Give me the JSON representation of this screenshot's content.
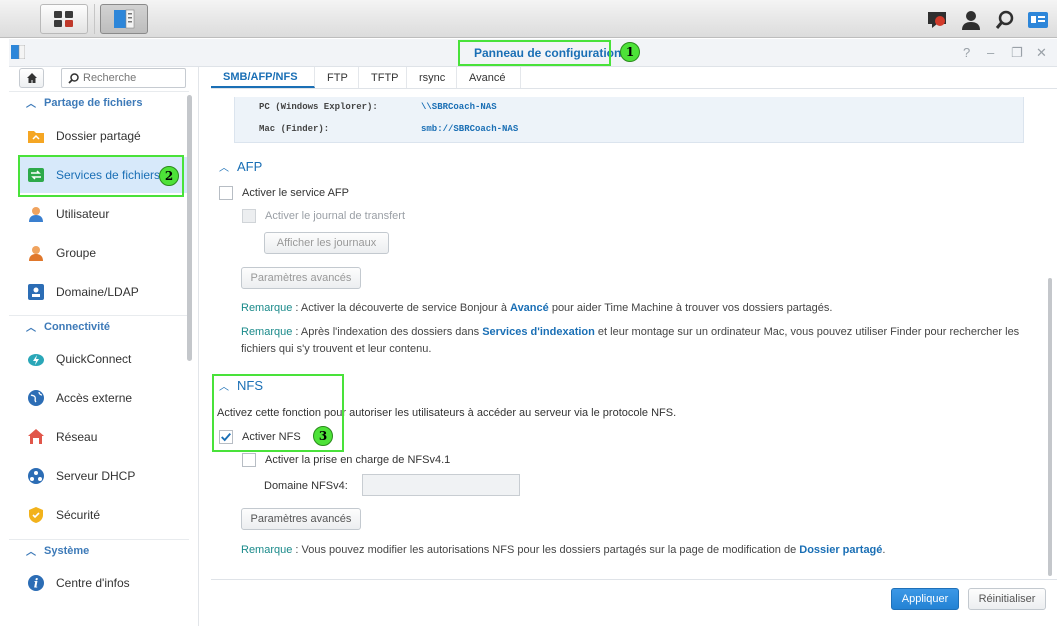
{
  "window": {
    "title": "Panneau de configuration",
    "controls": [
      "?",
      "–",
      "❐",
      "✕"
    ]
  },
  "annotations": [
    "1",
    "2",
    "3"
  ],
  "sidebar": {
    "search_placeholder": "Recherche",
    "sections": [
      {
        "label": "Partage de fichiers",
        "items": [
          {
            "label": "Dossier partagé",
            "icon": "folder-share-icon"
          },
          {
            "label": "Services de fichiers",
            "icon": "file-services-icon",
            "active": true
          },
          {
            "label": "Utilisateur",
            "icon": "user-icon"
          },
          {
            "label": "Groupe",
            "icon": "group-icon"
          },
          {
            "label": "Domaine/LDAP",
            "icon": "domain-ldap-icon"
          }
        ]
      },
      {
        "label": "Connectivité",
        "items": [
          {
            "label": "QuickConnect",
            "icon": "quickconnect-icon"
          },
          {
            "label": "Accès externe",
            "icon": "external-access-icon"
          },
          {
            "label": "Réseau",
            "icon": "network-icon"
          },
          {
            "label": "Serveur DHCP",
            "icon": "dhcp-server-icon"
          },
          {
            "label": "Sécurité",
            "icon": "security-icon"
          }
        ]
      },
      {
        "label": "Système",
        "items": [
          {
            "label": "Centre d'infos",
            "icon": "info-center-icon"
          }
        ]
      }
    ]
  },
  "tabs": [
    "SMB/AFP/NFS",
    "FTP",
    "TFTP",
    "rsync",
    "Avancé"
  ],
  "active_tab": "SMB/AFP/NFS",
  "access": {
    "pc_label": "PC (Windows Explorer):",
    "pc_value": "\\\\SBRCoach-NAS",
    "mac_label": "Mac (Finder):",
    "mac_value": "smb://SBRCoach-NAS"
  },
  "afp": {
    "title": "AFP",
    "enable_label": "Activer le service AFP",
    "enable_checked": false,
    "log_label": "Activer le journal de transfert",
    "show_logs_button": "Afficher les journaux",
    "advanced_button": "Paramètres avancés",
    "note1": {
      "prefix": "Remarque",
      "text_a": " : Activer la découverte de service Bonjour à ",
      "link": "Avancé",
      "text_b": " pour aider Time Machine à trouver vos dossiers partagés."
    },
    "note2": {
      "prefix": "Remarque",
      "text_a": " : Après l'indexation des dossiers dans ",
      "link": "Services d'indexation",
      "text_b": " et leur montage sur un ordinateur Mac, vous pouvez utiliser Finder pour rechercher les fichiers qui s'y trouvent et leur contenu."
    }
  },
  "nfs": {
    "title": "NFS",
    "description": "Activez cette fonction pour autoriser les utilisateurs à accéder au serveur via le protocole NFS.",
    "enable_label": "Activer NFS",
    "enable_checked": true,
    "nfsv41_label": "Activer la prise en charge de NFSv4.1",
    "nfsv41_checked": false,
    "domain_label": "Domaine NFSv4:",
    "domain_value": "",
    "advanced_button": "Paramètres avancés",
    "note": {
      "prefix": "Remarque",
      "text_a": " : Vous pouvez modifier les autorisations NFS pour les dossiers partagés sur la page de modification de ",
      "link": "Dossier partagé",
      "text_b": "."
    }
  },
  "footer": {
    "apply_button": "Appliquer",
    "reset_button": "Réinitialiser"
  },
  "colors": {
    "accent": "#1a6fb5",
    "highlight": "#49e23a",
    "active_item_bg": "#d7e9fa"
  }
}
